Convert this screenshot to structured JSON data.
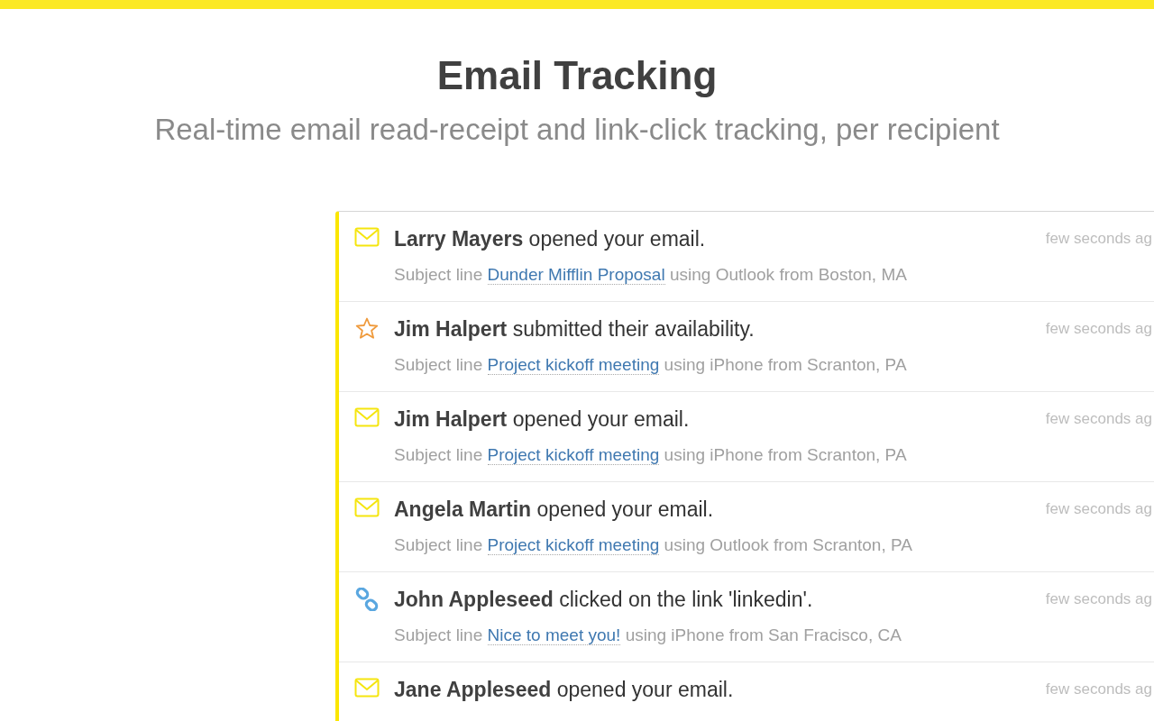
{
  "header": {
    "title": "Email Tracking",
    "subtitle": "Real-time email read-receipt and link-click tracking, per recipient"
  },
  "events": [
    {
      "kind": "open",
      "message": "**Larry Mayers** opened your email.",
      "time": "few seconds ag",
      "prefix": "Subject line",
      "subject": "Dunder Mifflin Proposal",
      "suffix": "using Outlook from Boston, MA"
    },
    {
      "kind": "star",
      "message": "**Jim Halpert** submitted their availability.",
      "time": "few seconds ag",
      "prefix": "Subject line",
      "subject": "Project kickoff meeting",
      "suffix": "using iPhone from Scranton, PA"
    },
    {
      "kind": "open",
      "message": "**Jim Halpert** opened your email.",
      "time": "few seconds ag",
      "prefix": "Subject line",
      "subject": "Project kickoff meeting",
      "suffix": "using iPhone from Scranton, PA"
    },
    {
      "kind": "open",
      "message": "**Angela Martin** opened your email.",
      "time": "few seconds ag",
      "prefix": "Subject line",
      "subject": "Project kickoff meeting",
      "suffix": "using Outlook from Scranton, PA"
    },
    {
      "kind": "link",
      "message": "**John Appleseed** clicked on the link 'linkedin'.",
      "time": "few seconds ag",
      "prefix": "Subject line",
      "subject": "Nice to meet you!",
      "suffix": "using iPhone from San Fracisco, CA"
    },
    {
      "kind": "open",
      "message": "**Jane Appleseed** opened your email.",
      "time": "few seconds ag"
    }
  ]
}
